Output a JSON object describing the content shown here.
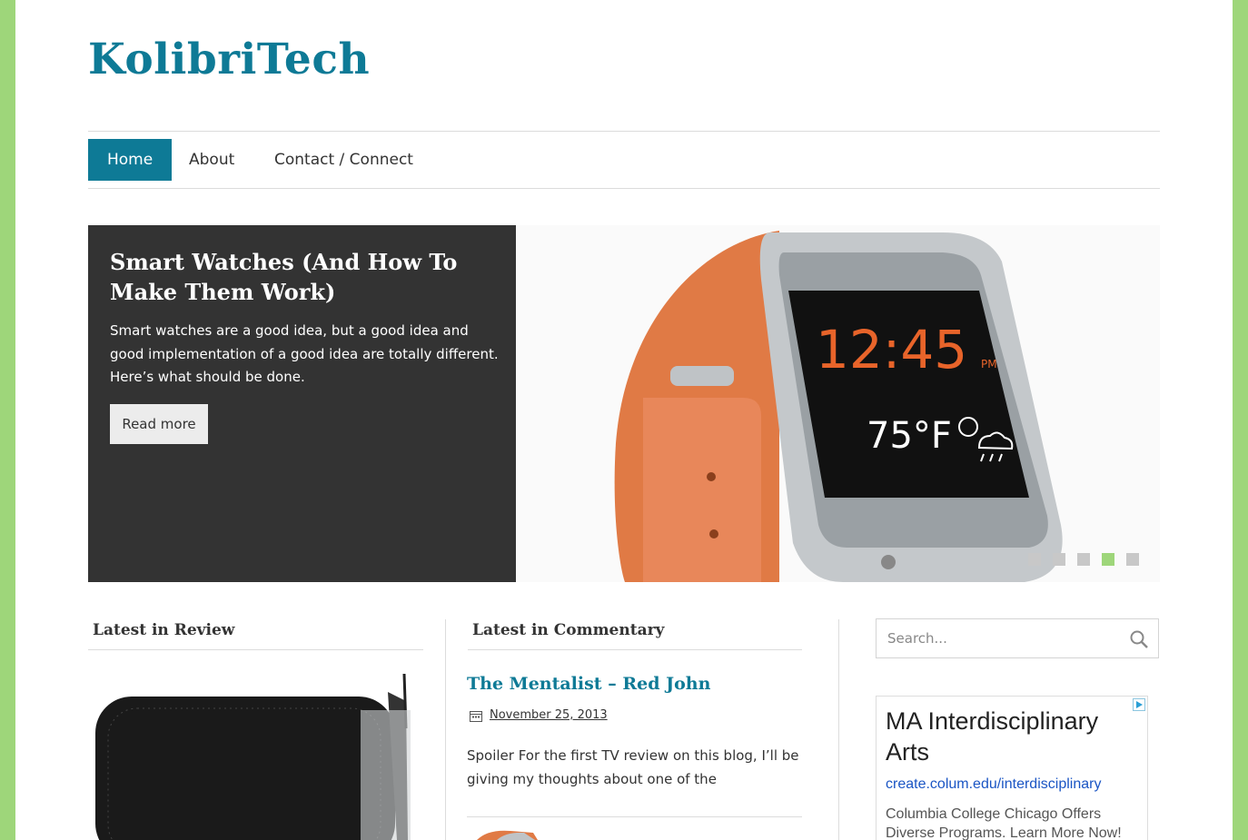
{
  "site": {
    "title": "KolibriTech"
  },
  "nav": {
    "items": [
      {
        "label": "Home",
        "active": true
      },
      {
        "label": "About"
      },
      {
        "label": "Contact / Connect"
      }
    ]
  },
  "slider": {
    "title": "Smart Watches (And How To Make Them Work)",
    "excerpt": "Smart watches are a good idea, but a good idea and good implementation of a good idea are totally different. Here’s what should be done.",
    "read_more": "Read more",
    "watch_time": "12:45",
    "watch_ampm": "PM",
    "watch_temp": "75°F",
    "dots": 5,
    "active_dot": 4
  },
  "review": {
    "heading": "Latest in Review"
  },
  "commentary": {
    "heading": "Latest in Commentary",
    "post_title": "The Mentalist – Red John",
    "post_date": "November 25, 2013",
    "post_excerpt": "Spoiler For the first TV review on this blog, I’ll be giving my thoughts about one of the"
  },
  "search": {
    "placeholder": "Search..."
  },
  "ad": {
    "title": "MA Interdisciplinary Arts",
    "url": "create.colum.edu/interdisciplinary",
    "description": "Columbia College Chicago Offers Diverse Programs. Learn More Now!"
  },
  "colors": {
    "accent": "#0e7a96",
    "frame": "#9ed67a",
    "panel": "#333333"
  }
}
